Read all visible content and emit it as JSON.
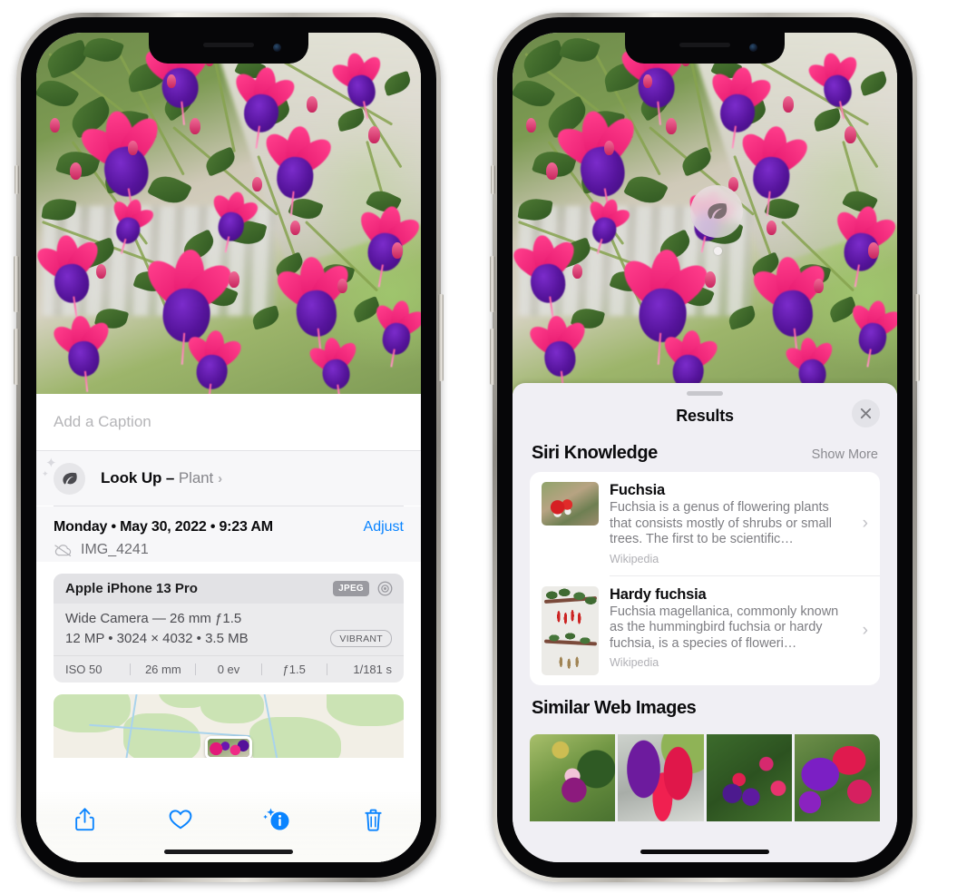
{
  "left_phone": {
    "photo": {
      "alt": "fuchsia-flowers-hanging-basket"
    },
    "caption_field": {
      "placeholder": "Add a Caption",
      "value": ""
    },
    "look_up": {
      "label_bold": "Look Up – ",
      "label_plain": "Plant",
      "chevron": "›",
      "icon": "leaf-icon",
      "sparkle": "✦"
    },
    "meta": {
      "date": "Monday • May 30, 2022 • 9:23 AM",
      "adjust_label": "Adjust",
      "filename": "IMG_4241",
      "cloud_icon": "icloud-slash-icon"
    },
    "exif": {
      "device": "Apple iPhone 13 Pro",
      "format_tag": "JPEG",
      "aperture_icon": "camera-aperture-icon",
      "lens": "Wide Camera — 26 mm ƒ1.5",
      "size": "12 MP • 3024 × 4032 • 3.5 MB",
      "style_tag": "VIBRANT",
      "stats": [
        "ISO 50",
        "26 mm",
        "0 ev",
        "ƒ1.5",
        "1/181 s"
      ]
    },
    "map": {
      "name": "location-map-thumbnail"
    },
    "toolbar": [
      {
        "name": "share-icon",
        "label": "Share"
      },
      {
        "name": "favorite-heart-icon",
        "label": "Favorite"
      },
      {
        "name": "info-sparkle-icon",
        "label": "Info",
        "active": true,
        "accent": "#0a84ff"
      },
      {
        "name": "trash-icon",
        "label": "Delete"
      }
    ]
  },
  "right_phone": {
    "photo": {
      "alt": "fuchsia-flowers-hanging-basket"
    },
    "visual_lookup_badge": {
      "icon": "leaf-icon",
      "name": "visual-lookup-leaf-badge"
    },
    "sheet": {
      "title": "Results",
      "close_icon": "✕",
      "grabber": "drag-handle"
    },
    "siri_knowledge": {
      "title": "Siri Knowledge",
      "show_more": "Show More",
      "items": [
        {
          "title": "Fuchsia",
          "description": "Fuchsia is a genus of flowering plants that consists mostly of shrubs or small trees. The first to be scientific…",
          "source": "Wikipedia",
          "chevron": "›",
          "thumb": "fuchsia-red-white-flowers"
        },
        {
          "title": "Hardy fuchsia",
          "description": "Fuchsia magellanica, commonly known as the hummingbird fuchsia or hardy fuchsia, is a species of floweri…",
          "source": "Wikipedia",
          "chevron": "›",
          "thumb": "hardy-fuchsia-specimen"
        }
      ]
    },
    "similar_web_images": {
      "title": "Similar Web Images",
      "images": [
        {
          "name": "web-image-1",
          "alt": "pink-purple-fuchsia-with-leaves"
        },
        {
          "name": "web-image-2",
          "alt": "red-magenta-fuchsia-closeup"
        },
        {
          "name": "web-image-3",
          "alt": "fuchsia-bush-many-blooms"
        },
        {
          "name": "web-image-4",
          "alt": "purple-red-fuchsia-cluster"
        }
      ]
    }
  },
  "colors": {
    "accent_blue": "#0a84ff",
    "sheet_bg": "#f0eff4",
    "card_bg": "#ffffff",
    "exif_bg": "#ebebed",
    "secondary_text": "#86868b"
  }
}
